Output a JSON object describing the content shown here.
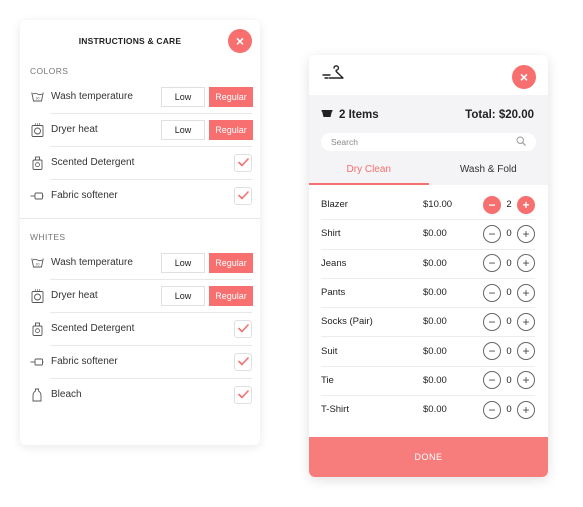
{
  "accent_color": "#f86f6f",
  "care_panel": {
    "title": "INSTRUCTIONS & CARE",
    "close_label": "×",
    "sections": [
      {
        "label": "COLORS",
        "rows": [
          {
            "icon": "wash-temperature-icon",
            "label": "Wash temperature",
            "type": "segmented",
            "options": [
              "Low",
              "Regular"
            ],
            "selected": "Regular"
          },
          {
            "icon": "dryer-heat-icon",
            "label": "Dryer heat",
            "type": "segmented",
            "options": [
              "Low",
              "Regular"
            ],
            "selected": "Regular"
          },
          {
            "icon": "detergent-icon",
            "label": "Scented Detergent",
            "type": "checkbox",
            "checked": true
          },
          {
            "icon": "fabric-softener-icon",
            "label": "Fabric softener",
            "type": "checkbox",
            "checked": true
          }
        ]
      },
      {
        "label": "WHITES",
        "rows": [
          {
            "icon": "wash-temperature-icon",
            "label": "Wash temperature",
            "type": "segmented",
            "options": [
              "Low",
              "Regular"
            ],
            "selected": "Regular"
          },
          {
            "icon": "dryer-heat-icon",
            "label": "Dryer heat",
            "type": "segmented",
            "options": [
              "Low",
              "Regular"
            ],
            "selected": "Regular"
          },
          {
            "icon": "detergent-icon",
            "label": "Scented Detergent",
            "type": "checkbox",
            "checked": true
          },
          {
            "icon": "fabric-softener-icon",
            "label": "Fabric softener",
            "type": "checkbox",
            "checked": true
          },
          {
            "icon": "bleach-icon",
            "label": "Bleach",
            "type": "checkbox",
            "checked": true
          }
        ]
      }
    ]
  },
  "order_panel": {
    "logo_icon": "hanger-logo-icon",
    "close_label": "×",
    "items_count": "2 Items",
    "total": "Total: $20.00",
    "search_placeholder": "Search",
    "tabs": [
      {
        "label": "Dry Clean",
        "active": true
      },
      {
        "label": "Wash & Fold",
        "active": false
      }
    ],
    "items": [
      {
        "name": "Blazer",
        "price": "$10.00",
        "qty": "2"
      },
      {
        "name": "Shirt",
        "price": "$0.00",
        "qty": "0"
      },
      {
        "name": "Jeans",
        "price": "$0.00",
        "qty": "0"
      },
      {
        "name": "Pants",
        "price": "$0.00",
        "qty": "0"
      },
      {
        "name": "Socks (Pair)",
        "price": "$0.00",
        "qty": "0"
      },
      {
        "name": "Suit",
        "price": "$0.00",
        "qty": "0"
      },
      {
        "name": "Tie",
        "price": "$0.00",
        "qty": "0"
      },
      {
        "name": "T-Shirt",
        "price": "$0.00",
        "qty": "0"
      }
    ],
    "done_label": "DONE"
  }
}
